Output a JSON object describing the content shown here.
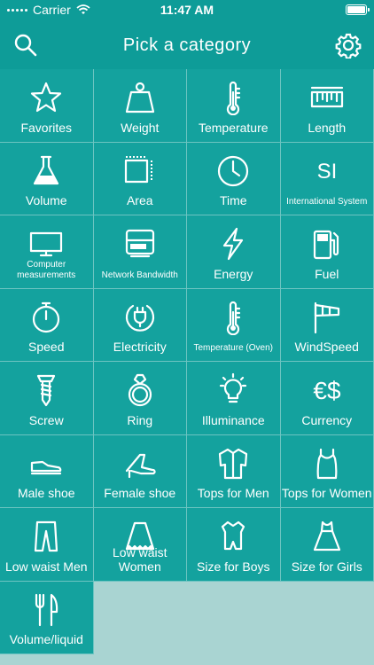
{
  "status": {
    "carrier": "Carrier",
    "time": "11:47 AM"
  },
  "header": {
    "title": "Pick a category",
    "search_icon": "search-icon",
    "settings_icon": "gear-icon"
  },
  "colors": {
    "bar": "#0E9C98",
    "tile": "#14A29E",
    "empty": "#A9D4D2",
    "divider": "#6CC4C1"
  },
  "categories": [
    {
      "label": "Favorites",
      "icon": "star-icon"
    },
    {
      "label": "Weight",
      "icon": "weight-icon"
    },
    {
      "label": "Temperature",
      "icon": "thermometer-icon"
    },
    {
      "label": "Length",
      "icon": "ruler-icon"
    },
    {
      "label": "Volume",
      "icon": "flask-icon"
    },
    {
      "label": "Area",
      "icon": "area-icon"
    },
    {
      "label": "Time",
      "icon": "clock-icon"
    },
    {
      "label": "International System",
      "icon": "si-icon"
    },
    {
      "label": "Computer measurements",
      "icon": "monitor-icon"
    },
    {
      "label": "Network Bandwidth",
      "icon": "router-icon"
    },
    {
      "label": "Energy",
      "icon": "lightning-icon"
    },
    {
      "label": "Fuel",
      "icon": "fuel-pump-icon"
    },
    {
      "label": "Speed",
      "icon": "stopwatch-icon"
    },
    {
      "label": "Electricity",
      "icon": "plug-icon"
    },
    {
      "label": "Temperature (Oven)",
      "icon": "oven-thermometer-icon"
    },
    {
      "label": "WindSpeed",
      "icon": "windsock-icon"
    },
    {
      "label": "Screw",
      "icon": "screw-icon"
    },
    {
      "label": "Ring",
      "icon": "ring-icon"
    },
    {
      "label": "Illuminance",
      "icon": "light-bulb-icon"
    },
    {
      "label": "Currency",
      "icon": "currency-icon"
    },
    {
      "label": "Male shoe",
      "icon": "male-shoe-icon"
    },
    {
      "label": "Female shoe",
      "icon": "heel-shoe-icon"
    },
    {
      "label": "Tops for Men",
      "icon": "shirt-icon"
    },
    {
      "label": "Tops for Women",
      "icon": "tank-top-icon"
    },
    {
      "label": "Low waist Men",
      "icon": "trousers-icon"
    },
    {
      "label": "Low waist Women",
      "icon": "skirt-icon"
    },
    {
      "label": "Size for Boys",
      "icon": "boy-romper-icon"
    },
    {
      "label": "Size for Girls",
      "icon": "girl-dress-icon"
    },
    {
      "label": "Volume/liquid",
      "icon": "fork-knife-icon"
    }
  ]
}
